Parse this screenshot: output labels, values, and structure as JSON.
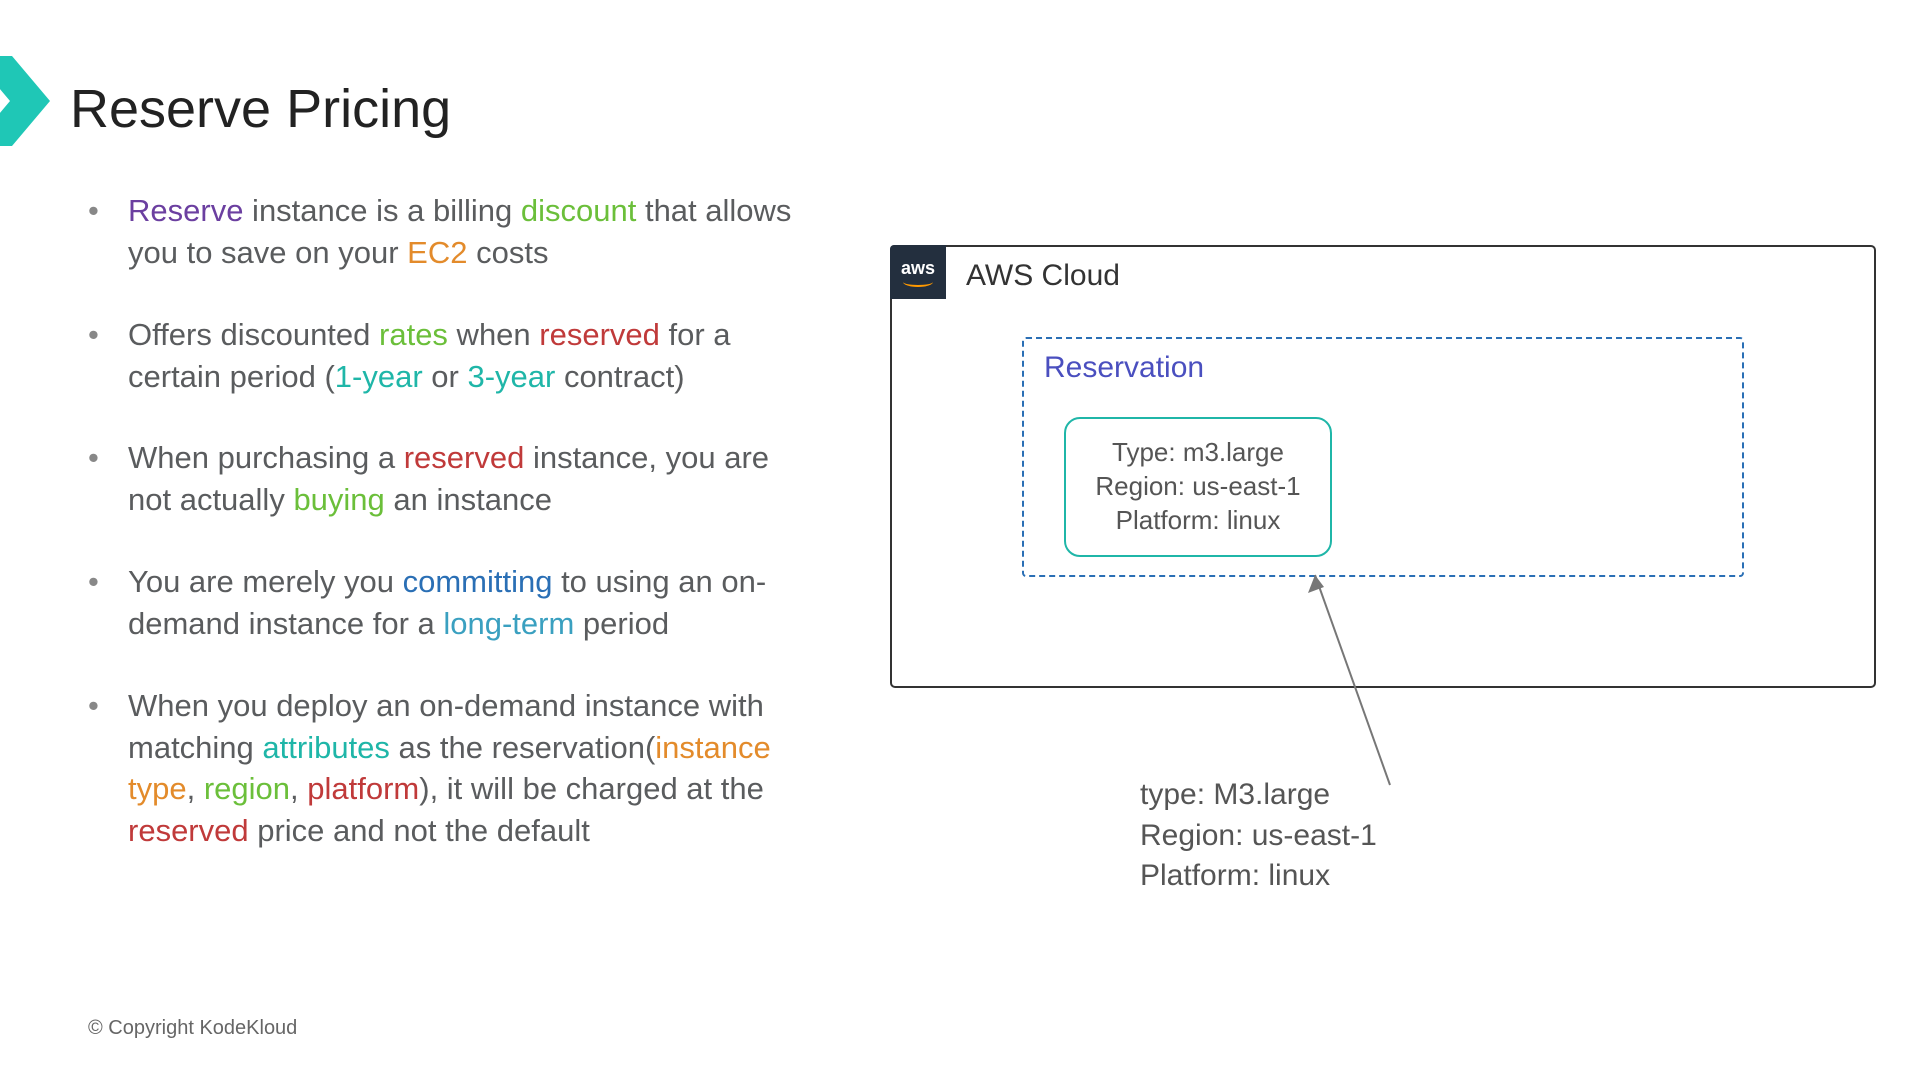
{
  "title": "Reserve Pricing",
  "bullets": {
    "b1": {
      "t1": "Reserve",
      "t2": " instance is a billing ",
      "t3": "discount",
      "t4": " that allows you to save on your ",
      "t5": "EC2",
      "t6": " costs"
    },
    "b2": {
      "t1": "Offers discounted ",
      "t2": "rates",
      "t3": " when ",
      "t4": "reserved",
      "t5": " for a certain period (",
      "t6": "1-year",
      "t7": " or ",
      "t8": "3-year",
      "t9": " contract)"
    },
    "b3": {
      "t1": "When purchasing a ",
      "t2": "reserved",
      "t3": " instance, you are not actually ",
      "t4": "buying",
      "t5": " an instance"
    },
    "b4": {
      "t1": "You are merely you ",
      "t2": "committing",
      "t3": " to using an on-demand instance for a ",
      "t4": "long-term",
      "t5": " period"
    },
    "b5": {
      "t1": "When you deploy an on-demand instance with matching ",
      "t2": "attributes",
      "t3": " as the reservation(",
      "t4": "instance type",
      "t5": ", ",
      "t6": "region",
      "t7": ", ",
      "t8": "platform",
      "t9": "), it will be charged at the ",
      "t10": "reserved",
      "t11": " price and not the default"
    }
  },
  "diagram": {
    "aws_label": "aws",
    "cloud_title": "AWS Cloud",
    "reservation_title": "Reservation",
    "card": {
      "line1": "Type: m3.large",
      "line2": "Region: us-east-1",
      "line3": "Platform: linux"
    },
    "caption": {
      "line1": "type: M3.large",
      "line2": "Region: us-east-1",
      "line3": "Platform: linux"
    }
  },
  "copyright": "© Copyright KodeKloud"
}
